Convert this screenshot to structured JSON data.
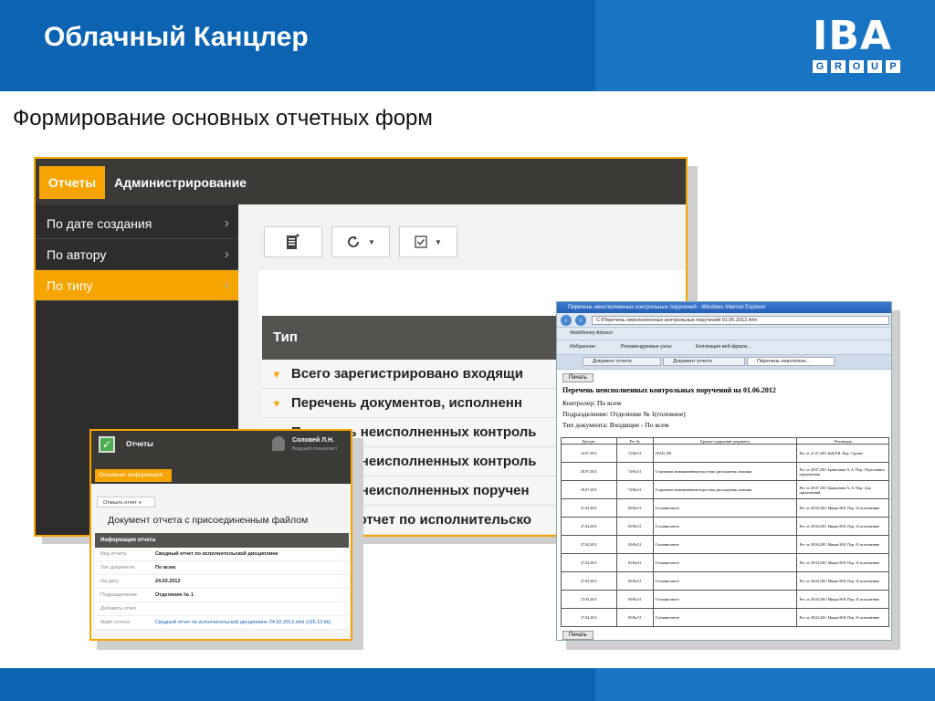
{
  "slide": {
    "title": "Облачный Канцлер",
    "subtitle": "Формирование основных отчетных форм",
    "logo_main": "IBA",
    "logo_sub": [
      "G",
      "R",
      "O",
      "U",
      "P"
    ]
  },
  "app1": {
    "tabs": [
      {
        "label": "Отчеты",
        "active": true
      },
      {
        "label": "Администрирование",
        "active": false
      }
    ],
    "sidebar": [
      {
        "label": "По дате создания",
        "active": false
      },
      {
        "label": "По автору",
        "active": false
      },
      {
        "label": "По типу",
        "active": true
      }
    ],
    "column_header": "Тип",
    "rows": [
      "Всего зарегистрировано входящи",
      "Перечень документов, исполненн",
      "Перечень неисполненных контроль",
      "Перечень неисполненных контроль",
      "Перечень неисполненных поручен",
      "Сводный отчет по исполнительско"
    ]
  },
  "app2": {
    "title": "Отчеты",
    "user_name": "Соловей Л.Н.",
    "user_role": "Ведущий специалист",
    "tab": "Основная информация",
    "open_button": "Открыть отчет",
    "doc_title": "Документ отчета с присоединенным файлом",
    "info_header": "Информация отчета",
    "fields": [
      {
        "label": "Вид отчета",
        "value": "Сводный отчет по исполнительской дисциплине"
      },
      {
        "label": "Тип документа",
        "value": "По всем"
      },
      {
        "label": "На дату",
        "value": "24.02.2012"
      },
      {
        "label": "Подразделение",
        "value": "Отделение № 1"
      },
      {
        "label": "Добавить отчет",
        "value": ""
      },
      {
        "label": "Файл отчета",
        "value": "Сводный отчет по исполнительской дисциплине 24.02.2012.mht (195.10 kb)"
      }
    ]
  },
  "app3": {
    "window_title": "Перечень неисполненных контрольных поручений - Windows Internet Explorer",
    "address": "C:\\Перечень неисполненных контрольных поручений 01.06.2012.mht",
    "bar2_text": "WebMoney Advisor",
    "favorites": [
      "Избранное",
      "Рекомендуемые узлы",
      "Коллекция веб-фрагм..."
    ],
    "tabs": [
      "Документ отчета",
      "Документ отчета",
      "Перечень неисполне..."
    ],
    "print_label": "Печать",
    "report_title": "Перечень неисполненных контрольных поручений на 01.06.2012",
    "report_lines": [
      "Контролер: По всем",
      "Подразделение: Отделение № 1(головное)",
      "Тип документа: Входящие - По всем"
    ],
    "headers": [
      "Дата рег.",
      "Рег. №",
      "Краткое содержание документа",
      "Резолюция"
    ],
    "rows": [
      [
        "22.07.2011",
        "72-Вх/11",
        "I-PAD_001",
        "Рез. от 21.07.2011 Бей П.В. Пор.: Срочно"
      ],
      [
        "28.07.2011",
        "74-Вх/11",
        "О причинах возникновения недостачи, расхождения, излишка",
        "Рез. от 28.07.2011 Бравосевич А. А. Пор.: Подготовить предложения"
      ],
      [
        "29.07.2011",
        "74-Вх/11",
        "О причинах возникновения недостачи, расхождения, излишка",
        "Рез. от 28.07.2011 Бравосевич А. А. Пор.: Для предложений"
      ],
      [
        "27.04.2011",
        "83-Вх/11",
        "О взаимозачете",
        "Рез. от 28.04.2011 Мицан Н.Н. Пор.: К исполнению"
      ],
      [
        "27.04.2011",
        "83-Вх/11",
        "О взаимозачете",
        "Рез. от 28.04.2011 Мицан Н.Н. Пор.: К исполнению"
      ],
      [
        "27.04.2011",
        "83-Вх/11",
        "О взаимозачете",
        "Рез. от 28.04.2011 Мицан Н.Н. Пор.: К исполнению"
      ],
      [
        "27.04.2011",
        "83-Вх/11",
        "О взаимозачете",
        "Рез. от 28.04.2011 Мицан Н.Н. Пор.: К исполнению"
      ],
      [
        "27.04.2011",
        "83-Вх/11",
        "О взаимозачете",
        "Рез. от 28.04.2011 Мицан Н.Н. Пор.: К исполнению"
      ],
      [
        "27.04.2011",
        "83-Вх/11",
        "О взаимозачете",
        "Рез. от 28.04.2011 Мицан Н.Н. Пор.: К исполнению"
      ],
      [
        "27.04.2011",
        "83-Вх/11",
        "О взаимозачете",
        "Рез. от 28.04.2011 Мицан Н.Н. Пор.: К исполнению"
      ]
    ]
  },
  "colors": {
    "brand_blue": "#0b63b2",
    "accent_orange": "#f5a400",
    "dark_bar": "#3b3a37"
  },
  "icons": [
    "new-report-icon",
    "refresh-icon",
    "checkbox-icon",
    "chevron-right-icon",
    "caret-down-icon",
    "user-icon",
    "check-app-icon",
    "ie-back-icon",
    "ie-forward-icon"
  ]
}
